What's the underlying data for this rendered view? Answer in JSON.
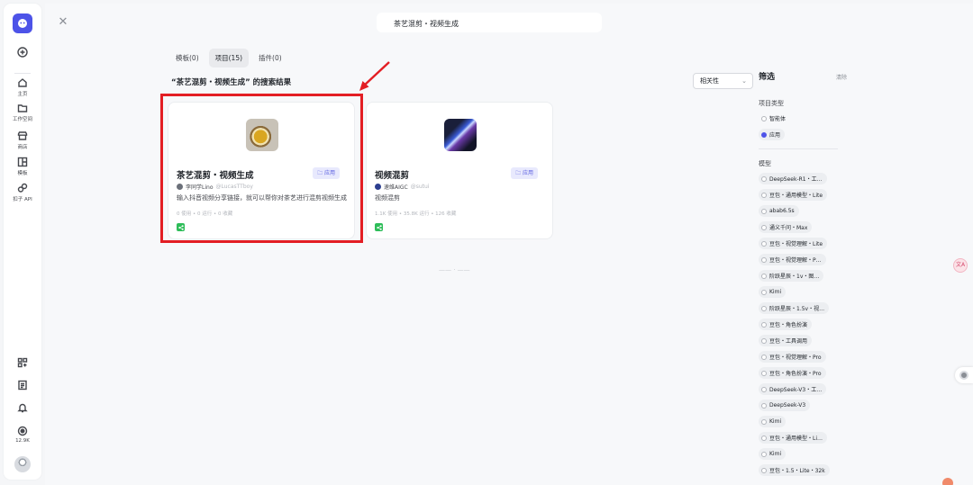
{
  "rail": {
    "create_label": "",
    "items": [
      {
        "label": "主页",
        "icon": "home-icon"
      },
      {
        "label": "工作空间",
        "icon": "folder-icon"
      },
      {
        "label": "商店",
        "icon": "store-icon"
      },
      {
        "label": "模板",
        "icon": "template-icon"
      },
      {
        "label": "扣子 API",
        "icon": "api-icon"
      }
    ],
    "bottom": {
      "followers": "12.9K"
    }
  },
  "search": {
    "value": "茶艺混剪・视频生成"
  },
  "tabs": [
    {
      "label": "模板(0)",
      "active": false
    },
    {
      "label": "项目(15)",
      "active": true
    },
    {
      "label": "插件(0)",
      "active": false
    }
  ],
  "results": {
    "title": "“茶艺混剪・视频生成” 的搜索结果",
    "sort": "相关性",
    "end_text": "—— · ——"
  },
  "cards": [
    {
      "name": "茶艺混剪・视频生成",
      "tag": "应用",
      "author": "李同学Lino",
      "handle": "@LucasTTboy",
      "desc": "输入抖音视频分享链接，就可以帮你对茶艺进行混剪视频生成",
      "stats": "0 使用 • 0 运行 • 0 收藏"
    },
    {
      "name": "视频混剪",
      "tag": "应用",
      "author": "速维AIGC",
      "handle": "@sutui",
      "desc": "视频混剪",
      "stats": "1.1K 使用 • 35.8K 运行 • 126 收藏"
    }
  ],
  "filter": {
    "title": "筛选",
    "clear": "清除",
    "type_title": "项目类型",
    "types": [
      {
        "label": "智能体",
        "checked": false
      },
      {
        "label": "应用",
        "checked": true
      }
    ],
    "model_title": "模型",
    "models": [
      "DeepSeek-R1・工…",
      "豆包・通用模型・Lite",
      "abab6.5s",
      "通义千问・Max",
      "豆包・视觉理解・Lite",
      "豆包・视觉理解・P…",
      "阶跃星辰・1v・图…",
      "Kimi",
      "阶跃星辰・1.5v・视…",
      "豆包・角色扮演",
      "豆包・工具调用",
      "豆包・视觉理解・Pro",
      "豆包・角色扮演・Pro",
      "DeepSeek-V3・工…",
      "DeepSeek-V3",
      "Kimi",
      "豆包・通用模型・Li…",
      "Kimi",
      "豆包・1.5・Lite・32k"
    ]
  },
  "colors": {
    "brand": "#4d53e8",
    "highlight": "#e31e24",
    "share_green": "#2ebd59"
  }
}
